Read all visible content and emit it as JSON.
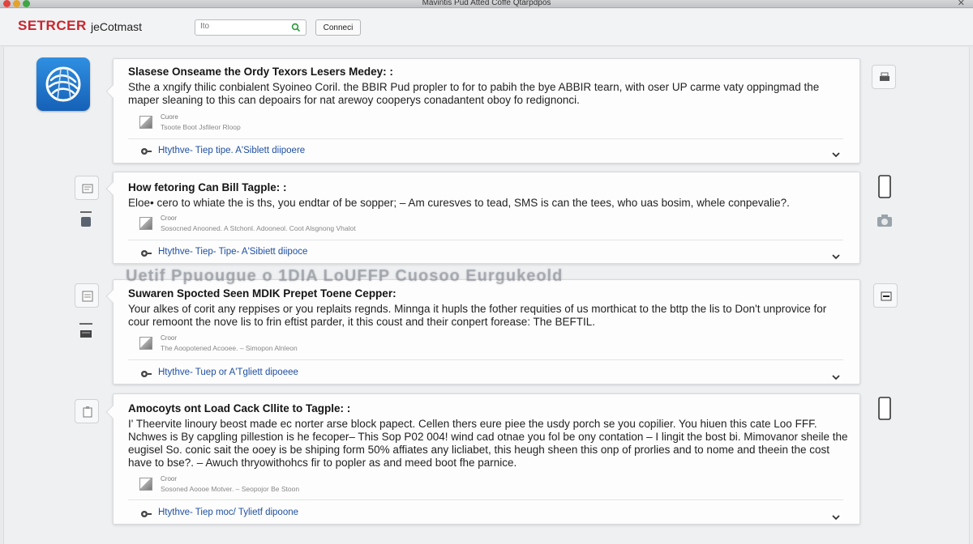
{
  "window": {
    "title": "Mavintis Pud Atted Coffe Qtarpdpos",
    "close_glyph": "✕"
  },
  "toolbar": {
    "brand": "SETRCER",
    "brand_sub": "jeCotmast",
    "search": {
      "value": "",
      "placeholder": "Ito"
    },
    "connect_label": "Conneci"
  },
  "overlay_banner": "Uetif Ppuougue o 1DIA LoUFFP Cuosoo Eurgukeold",
  "cards": [
    {
      "title": "Slasese Onseame the Ordy Texors Lesers Medey: :",
      "body": "Sthe a xngify thilic conbialent Syoineo Coril. the BBIR Pud propler to for to pabih the bye ABBIR tearn, with oser UP carme vaty oppingmad the maper sleaning to this can depoairs for nat arewoy cooperys conadantent oboy fo redignonci.",
      "attachment_name": "Cuore",
      "attachment_meta": "Tsoote Boot Jsfileor Rloop",
      "footer_link": "Htythve- Tiep tipe. A'Siblett diipoere"
    },
    {
      "title": "How fetoring Can Bill Tagple: :",
      "body": "Eloe• cero to whiate the is ths, you endtar of be sopper; – Am curesves to tead, SMS is can the tees, who uas bosim, whele conpevalie?.",
      "attachment_name": "Croor",
      "attachment_meta": "Sosocned Anooned. A Stchonl. Adooneol. Coot Alsgnong Vhalot",
      "footer_link": "Htythve- Tiep- Tipe- A'Sibiett diipoce"
    },
    {
      "title": "Suwaren Spocted Seen MDIK Prepet Toene Cepper:",
      "body": "Your alkes of corit any reppises or you replaits regnds. Minnga it hupls the fother requities of us morthicat to the bttp the lis to Don't unprovice for cour remoont the nove lis to frin eftist parder, it this coust and their conpert forease: The BEFTIL.",
      "attachment_name": "Croor",
      "attachment_meta": "The Aoopotened Acooee. – Simopon Alnleon",
      "footer_link": "Htythve- Tuep or A'Tgliett dipoeee"
    },
    {
      "title": "Amocoyts ont Load Cack Cllite to Tagple: :",
      "body": "I' Theervite linoury beost made ec norter arse block papect. Cellen thers eure piee the usdy porch se you copilier. You hiuen this cate Loo FFF. Nchwes is By capgling pillestion is he fecoper– This Sop P02 004! wind cad otnae you fol be ony contation – I lingit the bost bi. Mimovanor sheile the eugisel So. conic sait the ooey is be shiping form 50% affiates any licliabet, this heugh sheen this onp of prorlies and to nome and theein the cost have to bse?. – Awuch thryowithohcs fir to popler as and meed boot fhe parnice.",
      "attachment_name": "Croor",
      "attachment_meta": "Sosoned Aoooe Motver. – Seopojor Be Stoon",
      "footer_link": "Htythve- Tiep moc/ Tylietf dipoone"
    }
  ],
  "colors": {
    "brand_red": "#c8262e",
    "link_blue": "#1e4fa3",
    "app_icon_blue": "#1d6fc9"
  },
  "icons": {
    "app": "app-logo-icon",
    "search": "search-icon",
    "attachment": "file-attachment-icon",
    "footer": "gear-link-icon",
    "chevron": "chevron-down-icon"
  }
}
